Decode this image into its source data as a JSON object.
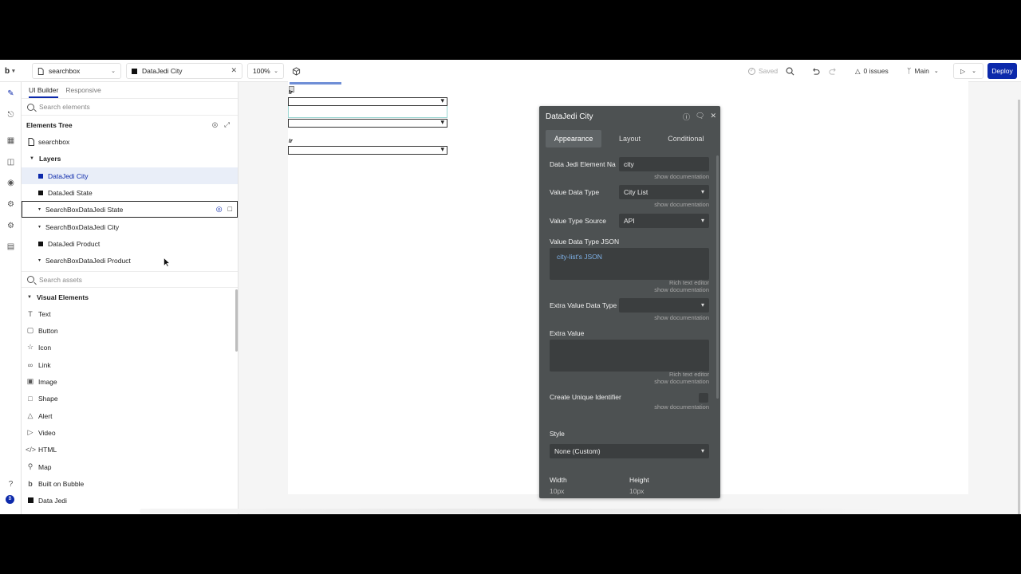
{
  "topbar": {
    "page_select": "searchbox",
    "element_select": "DataJedi City",
    "zoom": "100%",
    "saved": "Saved",
    "issues": "0 issues",
    "branch": "Main",
    "deploy": "Deploy"
  },
  "panel": {
    "tabs": [
      "UI Builder",
      "Responsive"
    ],
    "search_placeholder": "Search elements",
    "tree_title": "Elements Tree",
    "page": "searchbox",
    "layers": "Layers",
    "items": [
      {
        "label": "DataJedi City",
        "kind": "square"
      },
      {
        "label": "DataJedi State",
        "kind": "square"
      },
      {
        "label": "SearchBoxDataJedi State",
        "kind": "caret"
      },
      {
        "label": "SearchBoxDataJedi City",
        "kind": "caret"
      },
      {
        "label": "DataJedi Product",
        "kind": "square"
      },
      {
        "label": "SearchBoxDataJedi Product",
        "kind": "caret"
      }
    ],
    "assets_placeholder": "Search assets",
    "visual_elements": "Visual Elements",
    "assets": [
      {
        "label": "Text",
        "icon": "text-icon"
      },
      {
        "label": "Button",
        "icon": "button-icon"
      },
      {
        "label": "Icon",
        "icon": "star-icon"
      },
      {
        "label": "Link",
        "icon": "link-icon"
      },
      {
        "label": "Image",
        "icon": "image-icon"
      },
      {
        "label": "Shape",
        "icon": "shape-icon"
      },
      {
        "label": "Alert",
        "icon": "alert-icon"
      },
      {
        "label": "Video",
        "icon": "video-icon"
      },
      {
        "label": "HTML",
        "icon": "code-icon"
      },
      {
        "label": "Map",
        "icon": "map-pin-icon"
      },
      {
        "label": "Built on Bubble",
        "icon": "bubble-logo-icon"
      },
      {
        "label": "Data Jedi",
        "icon": "plugin-square-icon"
      }
    ]
  },
  "canvas": {
    "tag1": "Ir",
    "tag2": "Ir"
  },
  "editor": {
    "title": "DataJedi City",
    "tabs": [
      "Appearance",
      "Layout",
      "Conditional"
    ],
    "show_doc": "show documentation",
    "rich_text": "Rich text editor",
    "fields": {
      "element_name_label": "Data Jedi Element Na",
      "element_name_value": "city",
      "value_type_label": "Value Data Type",
      "value_type_value": "City List",
      "source_label": "Value Type Source",
      "source_value": "API",
      "json_label": "Value Data Type JSON",
      "json_value": "city-list's JSON",
      "extra_type_label": "Extra Value Data Type",
      "extra_value_label": "Extra Value",
      "unique_label": "Create Unique Identifier",
      "style_label": "Style",
      "style_value": "None (Custom)",
      "width_label": "Width",
      "width_value": "10px",
      "height_label": "Height",
      "height_value": "10px"
    }
  }
}
